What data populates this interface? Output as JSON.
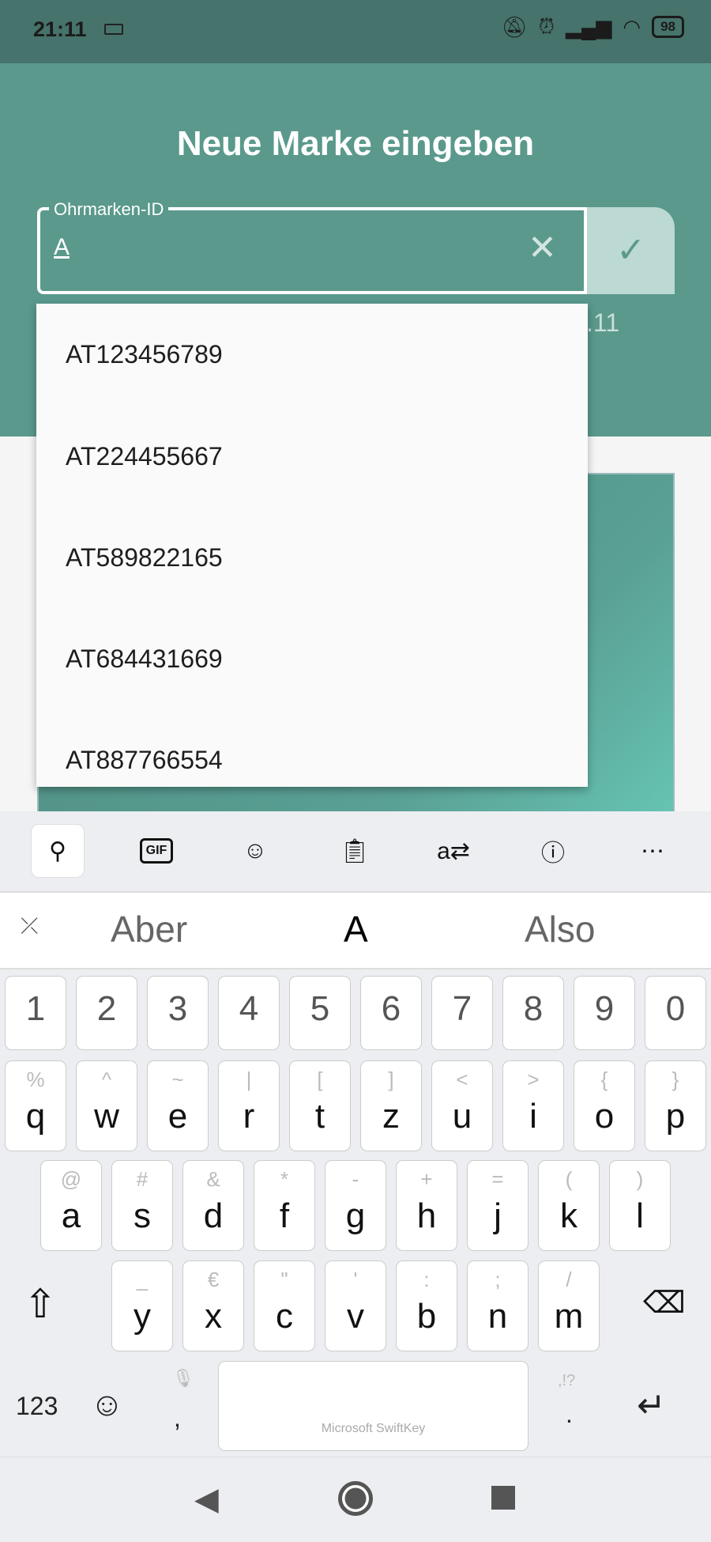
{
  "status_bar": {
    "time": "21:11",
    "battery": "98",
    "icons": [
      "keyboard-icon",
      "bell-off-icon",
      "alarm-icon",
      "signal-icon",
      "wifi-icon",
      "battery-icon"
    ]
  },
  "header": {
    "title": "Neue Marke eingeben"
  },
  "ear_tag_field": {
    "label": "Ohrmarken-ID",
    "value": "A",
    "clear_icon": "close-icon",
    "confirm_icon": "check-icon"
  },
  "behind_text": ".11",
  "suggestions": [
    "AT123456789",
    "AT224455667",
    "AT589822165",
    "AT684431669",
    "AT887766554"
  ],
  "colors": {
    "header": "#5a998c",
    "status_bar": "#46736b",
    "confirm": "#bcd9d3",
    "keyboard": "#eceef1"
  },
  "keyboard": {
    "toolbar": [
      "search-icon",
      "gif-icon",
      "sticker-icon",
      "clipboard-icon",
      "translate-icon",
      "info-icon",
      "more-icon"
    ],
    "gif_label": "GIF",
    "predictions": [
      "Aber",
      "A",
      "Also"
    ],
    "number_row": [
      "1",
      "2",
      "3",
      "4",
      "5",
      "6",
      "7",
      "8",
      "9",
      "0"
    ],
    "rows": [
      {
        "keys": [
          "q",
          "w",
          "e",
          "r",
          "t",
          "z",
          "u",
          "i",
          "o",
          "p"
        ],
        "hints": [
          "%",
          "^",
          "~",
          "|",
          "[",
          "]",
          "<",
          ">",
          "{",
          "}"
        ]
      },
      {
        "keys": [
          "a",
          "s",
          "d",
          "f",
          "g",
          "h",
          "j",
          "k",
          "l"
        ],
        "hints": [
          "@",
          "#",
          "&",
          "*",
          "-",
          "+",
          "=",
          "(",
          ")"
        ]
      },
      {
        "keys": [
          "y",
          "x",
          "c",
          "v",
          "b",
          "n",
          "m"
        ],
        "hints": [
          "_",
          "€",
          "\"",
          "'",
          ":",
          ";",
          "/"
        ]
      }
    ],
    "numbers_label": "123",
    "comma": ",",
    "period": ".",
    "period_hint": ",!?",
    "space_brand": "Microsoft SwiftKey"
  }
}
